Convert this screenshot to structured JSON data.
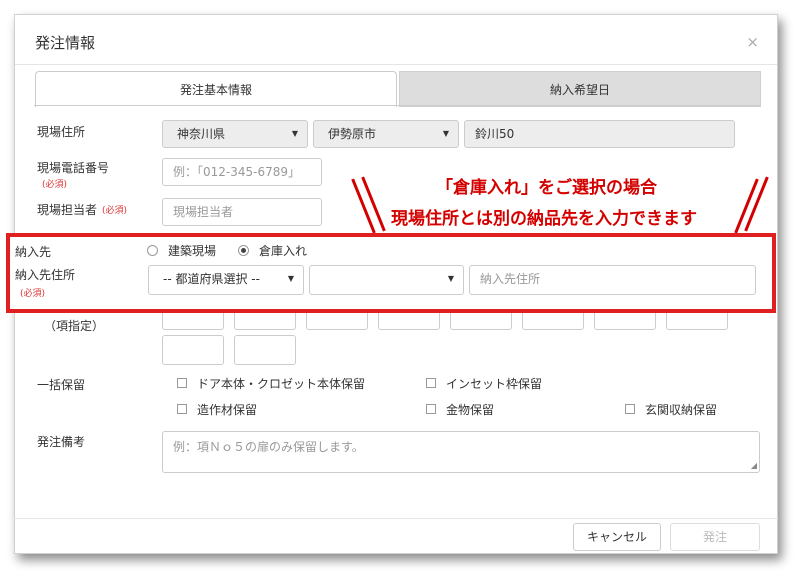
{
  "modal": {
    "title": "発注情報",
    "close": "×"
  },
  "tabs": [
    {
      "label": "発注基本情報",
      "active": true
    },
    {
      "label": "納入希望日",
      "active": false
    }
  ],
  "form": {
    "site_address": {
      "label": "現場住所",
      "prefecture": "神奈川県",
      "city": "伊勢原市",
      "street": "鈴川50"
    },
    "site_phone": {
      "label": "現場電話番号",
      "required": "(必須)",
      "placeholder": "例：「012-345-6789」"
    },
    "site_contact": {
      "label": "現場担当者",
      "required": "(必須)",
      "placeholder": "現場担当者"
    },
    "delivery_dest": {
      "label": "納入先",
      "options": [
        "建築現場",
        "倉庫入れ"
      ],
      "selected": "倉庫入れ"
    },
    "delivery_address": {
      "label": "納入先住所",
      "required": "(必須)",
      "prefecture_placeholder": "-- 都道府県選択 --",
      "city_value": "",
      "address_placeholder": "納入先住所"
    },
    "item_spec": {
      "label": "（項指定）"
    },
    "bulk_hold": {
      "label": "一括保留",
      "options": [
        "ドア本体・クロゼット本体保留",
        "インセット枠保留",
        "造作材保留",
        "金物保留",
        "玄関収納保留"
      ]
    },
    "remarks": {
      "label": "発注備考",
      "placeholder": "例：項Ｎｏ５の扉のみ保留します。"
    }
  },
  "callout": {
    "line1": "「倉庫入れ」をご選択の場合",
    "line2": "現場住所とは別の納品先を入力できます"
  },
  "footer": {
    "cancel": "キャンセル",
    "submit": "発注"
  },
  "colors": {
    "highlight": "#e02020",
    "callout_text": "#d40000"
  }
}
